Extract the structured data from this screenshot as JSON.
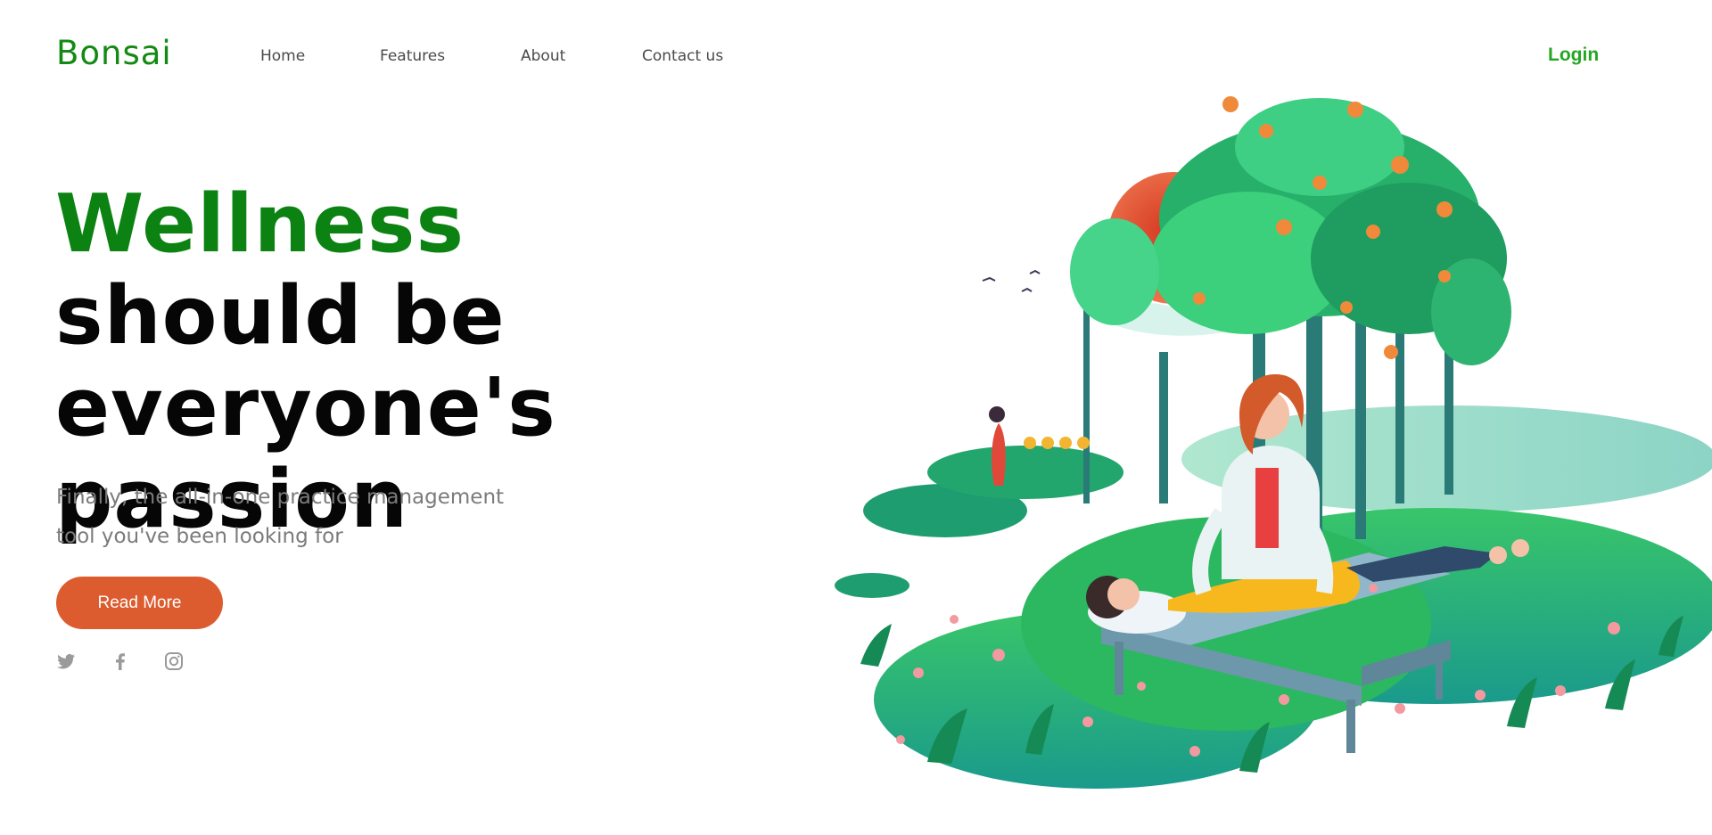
{
  "brand": {
    "name": "Bonsai",
    "color": "#138a13"
  },
  "nav": {
    "items": [
      {
        "label": "Home"
      },
      {
        "label": "Features"
      },
      {
        "label": "About"
      },
      {
        "label": "Contact us"
      }
    ],
    "login_label": "Login"
  },
  "hero": {
    "title_accent": "Wellness",
    "title_rest": "should be everyone's passion",
    "subtitle_line1": "Finally, the all-in-one practice management",
    "subtitle_line2": "tool you've been looking for",
    "cta_label": "Read More"
  },
  "social": [
    {
      "icon": "twitter-icon"
    },
    {
      "icon": "facebook-icon"
    },
    {
      "icon": "instagram-icon"
    }
  ],
  "colors": {
    "accent_green": "#0b8212",
    "login_green": "#23a723",
    "cta_orange": "#dc5c2f",
    "text_dark": "#060606",
    "text_muted": "#7b7b7b"
  }
}
